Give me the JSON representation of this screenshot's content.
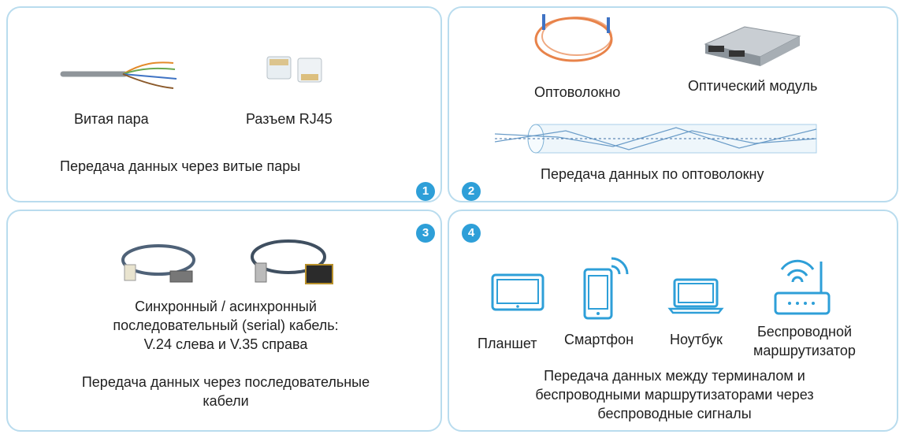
{
  "panels": [
    {
      "number": "1",
      "labels": {
        "twisted_pair": "Витая пара",
        "rj45": "Разъем RJ45"
      },
      "caption": "Передача данных через витые пары"
    },
    {
      "number": "2",
      "labels": {
        "fiber": "Оптоволокно",
        "module": "Оптический модуль"
      },
      "caption": "Передача данных по оптоволокну"
    },
    {
      "number": "3",
      "labels": {
        "serial_line1": "Синхронный / асинхронный",
        "serial_line2": "последовательный (serial) кабель:",
        "serial_line3": "V.24 слева и V.35 справа"
      },
      "caption_line1": "Передача данных через последовательные",
      "caption_line2": "кабели"
    },
    {
      "number": "4",
      "labels": {
        "tablet": "Планшет",
        "smartphone": "Смартфон",
        "laptop": "Ноутбук",
        "router_line1": "Беспроводной",
        "router_line2": "маршрутизатор"
      },
      "caption_line1": "Передача данных между терминалом и",
      "caption_line2": "беспроводными маршрутизаторами через",
      "caption_line3": "беспроводные сигналы"
    }
  ],
  "colors": {
    "accent": "#2e9fd8",
    "border": "#b9dcee"
  }
}
